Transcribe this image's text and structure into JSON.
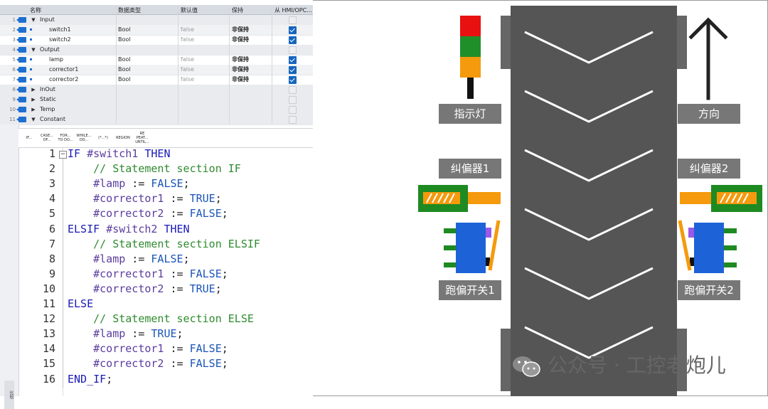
{
  "table": {
    "headers": {
      "name": "名称",
      "datatype": "数据类型",
      "default": "默认值",
      "retain": "保持",
      "hmi": "从 HMI/OPC..."
    },
    "rows": [
      {
        "num": "1",
        "kind": "section",
        "expanded": true,
        "name": "Input"
      },
      {
        "num": "2",
        "kind": "var",
        "name": "switch1",
        "datatype": "Bool",
        "default": "false",
        "retain": "非保持",
        "hmi": true
      },
      {
        "num": "3",
        "kind": "var",
        "name": "switch2",
        "datatype": "Bool",
        "default": "false",
        "retain": "非保持",
        "hmi": true
      },
      {
        "num": "4",
        "kind": "section",
        "expanded": true,
        "name": "Output"
      },
      {
        "num": "5",
        "kind": "var",
        "name": "lamp",
        "datatype": "Bool",
        "default": "false",
        "retain": "非保持",
        "hmi": true
      },
      {
        "num": "6",
        "kind": "var",
        "name": "corrector1",
        "datatype": "Bool",
        "default": "false",
        "retain": "非保持",
        "hmi": true
      },
      {
        "num": "7",
        "kind": "var",
        "name": "corrector2",
        "datatype": "Bool",
        "default": "false",
        "retain": "非保持",
        "hmi": true
      },
      {
        "num": "8",
        "kind": "section",
        "expanded": false,
        "name": "InOut"
      },
      {
        "num": "9",
        "kind": "section",
        "expanded": false,
        "name": "Static"
      },
      {
        "num": "10",
        "kind": "section",
        "expanded": false,
        "name": "Temp"
      },
      {
        "num": "11",
        "kind": "section",
        "expanded": true,
        "name": "Constant"
      }
    ]
  },
  "toolbar": {
    "buttons": [
      {
        "l1": "IF...",
        "l2": "",
        "l3": ""
      },
      {
        "l1": "CASE...",
        "l2": "OF...",
        "l3": ""
      },
      {
        "l1": "FOR...",
        "l2": "TO DO...",
        "l3": ""
      },
      {
        "l1": "WHILE...",
        "l2": "DO...",
        "l3": ""
      },
      {
        "l1": "(*...*)",
        "l2": "",
        "l3": ""
      },
      {
        "l1": "REGION",
        "l2": "",
        "l3": ""
      },
      {
        "l1": "RE",
        "l2": "PEAT...",
        "l3": "UNTIL..."
      }
    ]
  },
  "side_tab": "比较",
  "code": {
    "lines": [
      {
        "num": "1",
        "text": "IF #switch1 THEN"
      },
      {
        "num": "2",
        "text": "    // Statement section IF"
      },
      {
        "num": "3",
        "text": "    #lamp := FALSE;"
      },
      {
        "num": "4",
        "text": "    #corrector1 := TRUE;"
      },
      {
        "num": "5",
        "text": "    #corrector2 := FALSE;"
      },
      {
        "num": "6",
        "text": "ELSIF #switch2 THEN"
      },
      {
        "num": "7",
        "text": "    // Statement section ELSIF"
      },
      {
        "num": "8",
        "text": "    #lamp := FALSE;"
      },
      {
        "num": "9",
        "text": "    #corrector1 := FALSE;"
      },
      {
        "num": "10",
        "text": "    #corrector2 := TRUE;"
      },
      {
        "num": "11",
        "text": "ELSE"
      },
      {
        "num": "12",
        "text": "    // Statement section ELSE"
      },
      {
        "num": "13",
        "text": "    #lamp := TRUE;"
      },
      {
        "num": "14",
        "text": "    #corrector1 := FALSE;"
      },
      {
        "num": "15",
        "text": "    #corrector2 := FALSE;"
      },
      {
        "num": "16",
        "text": "END_IF;"
      }
    ],
    "colors": {
      "keyword": "#1a1ab8",
      "comment": "#2e8b2e",
      "variable": "#5b3c9e",
      "constant": "#1a55b8",
      "default": "#222222"
    }
  },
  "diagram": {
    "labels": {
      "lamp": "指示灯",
      "direction": "方向",
      "corrector1": "纠偏器1",
      "corrector2": "纠偏器2",
      "switch1": "跑偏开关1",
      "switch2": "跑偏开关2"
    },
    "colors": {
      "belt": "#555555",
      "chevron": "#ffffff",
      "tower_red": "#e81010",
      "tower_green": "#1f8f2a",
      "tower_orange": "#f59a0c",
      "corrector_green": "#1e8a22",
      "corrector_orange": "#f59a0c",
      "switch_blue": "#1e62d8",
      "switch_purple": "#9b59e8",
      "label_bg": "#777777",
      "arrow": "#222222"
    }
  },
  "watermark": {
    "icon": "wechat-icon",
    "text": "公众号 · 工控老炮儿"
  }
}
